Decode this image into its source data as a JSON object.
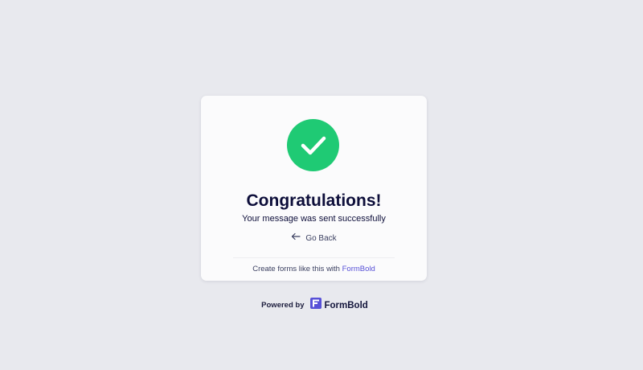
{
  "card": {
    "title": "Congratulations!",
    "subtitle": "Your message was sent successfully",
    "go_back_label": "Go Back",
    "footer_prefix": "Create forms like this with",
    "footer_link": "FormBold"
  },
  "powered_by": {
    "label": "Powered by",
    "brand": "FormBold"
  },
  "icons": {
    "success": "checkmark-icon",
    "go_back": "arrow-left-icon",
    "brand_logo": "formbold-logo-icon"
  },
  "colors": {
    "background": "#e8e9ee",
    "card": "#fbfbfc",
    "success_green": "#1fca74",
    "heading": "#0d0e3a",
    "link": "#5750d7",
    "brand_purple": "#5750d7"
  }
}
